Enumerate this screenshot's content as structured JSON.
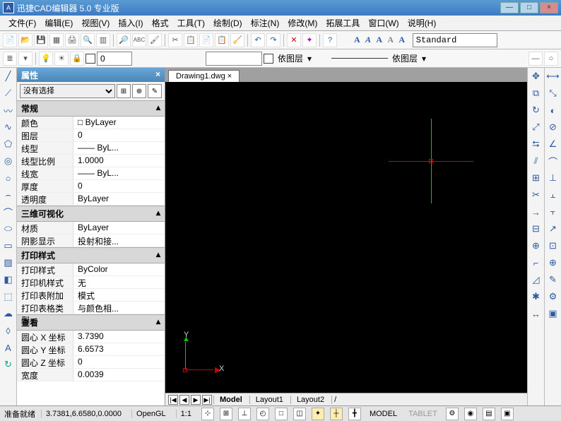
{
  "title": "迅捷CAD编辑器 5.0 专业版",
  "winbtns": {
    "min": "—",
    "max": "□",
    "close": "×"
  },
  "menu": [
    "文件(F)",
    "编辑(E)",
    "视图(V)",
    "插入(I)",
    "格式",
    "工具(T)",
    "绘制(D)",
    "标注(N)",
    "修改(M)",
    "拓展工具",
    "窗口(W)",
    "说明(H)"
  ],
  "toolbar1": {
    "style": "Standard",
    "dimA": [
      "A",
      "A",
      "A",
      "A",
      "A"
    ]
  },
  "toolbar2": {
    "colorval": "0",
    "layerbox": "",
    "bylayer1": "依图层",
    "bylayer2": "依图层"
  },
  "tab": {
    "active": "Drawing1.dwg"
  },
  "prop": {
    "title": "属性",
    "selector": "没有选择",
    "sections": [
      {
        "name": "常规",
        "rows": [
          {
            "k": "颜色",
            "v": "□ ByLayer"
          },
          {
            "k": "图层",
            "v": "0"
          },
          {
            "k": "线型",
            "v": "—— ByL..."
          },
          {
            "k": "线型比例",
            "v": "1.0000"
          },
          {
            "k": "线宽",
            "v": "—— ByL..."
          },
          {
            "k": "厚度",
            "v": "0"
          },
          {
            "k": "透明度",
            "v": "ByLayer"
          }
        ]
      },
      {
        "name": "三维可视化",
        "rows": [
          {
            "k": "材质",
            "v": "ByLayer"
          },
          {
            "k": "阴影显示",
            "v": "投射和接..."
          }
        ]
      },
      {
        "name": "打印样式",
        "rows": [
          {
            "k": "打印样式",
            "v": "ByColor"
          },
          {
            "k": "打印机样式表",
            "v": "无"
          },
          {
            "k": "打印表附加到",
            "v": "模式"
          },
          {
            "k": "打印表格类型",
            "v": "与颜色相..."
          }
        ]
      },
      {
        "name": "查看",
        "rows": [
          {
            "k": "圆心 X 坐标",
            "v": "3.7390"
          },
          {
            "k": "圆心 Y 坐标",
            "v": "6.6573"
          },
          {
            "k": "圆心 Z 坐标",
            "v": "0"
          },
          {
            "k": "宽度",
            "v": "0.0039"
          }
        ]
      }
    ]
  },
  "axis": {
    "x": "X",
    "y": "Y"
  },
  "bottomtabs": {
    "nav": [
      "|◀",
      "◀",
      "▶",
      "▶|"
    ],
    "tabs": [
      "Model",
      "Layout1",
      "Layout2"
    ]
  },
  "status": {
    "ready": "准备就绪",
    "coords": "3.7381,6.6580,0.0000",
    "renderer": "OpenGL",
    "scale": "1:1",
    "model": "MODEL",
    "tablet": "TABLET"
  }
}
